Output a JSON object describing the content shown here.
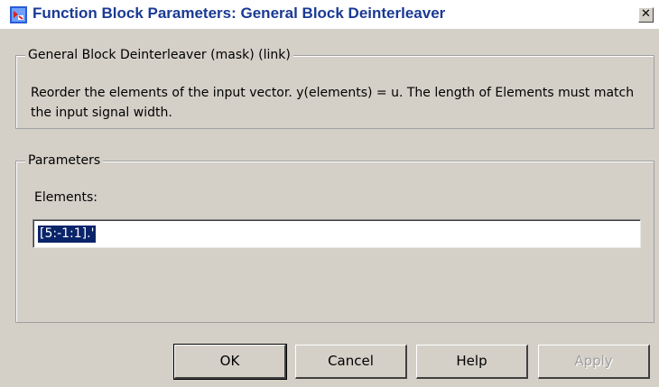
{
  "window": {
    "title": "Function Block Parameters: General Block Deinterleaver",
    "close_glyph": "✕",
    "icon": "simulink-block-icon"
  },
  "mask_group": {
    "legend": "General Block Deinterleaver (mask) (link)",
    "description": "Reorder the elements of the input vector. y(elements) = u.  The length of Elements must match the input signal width."
  },
  "parameters_group": {
    "legend": "Parameters",
    "elements_label": "Elements:",
    "elements_value": "[5:-1:1].'"
  },
  "buttons": {
    "ok": "OK",
    "cancel": "Cancel",
    "help": "Help",
    "apply": "Apply"
  }
}
